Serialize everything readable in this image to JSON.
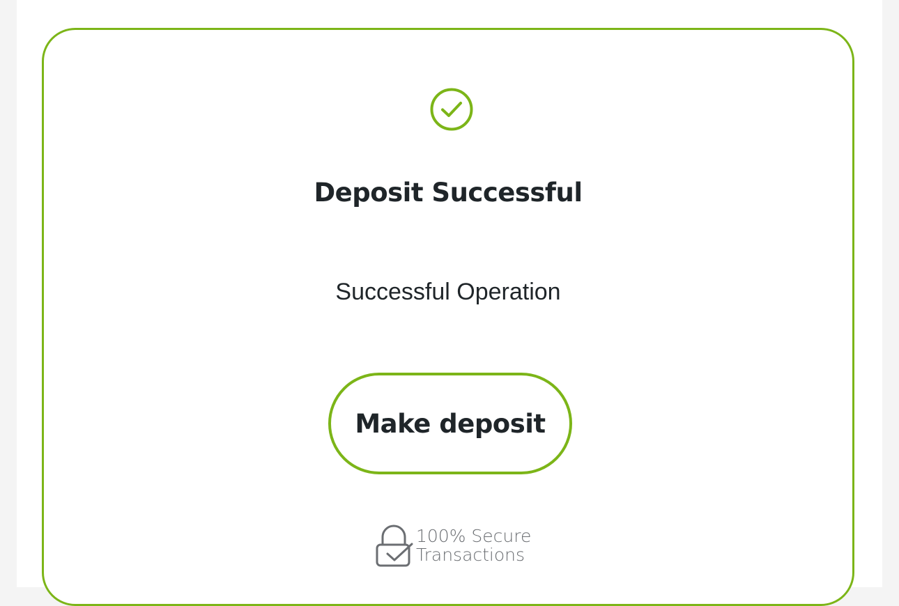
{
  "colors": {
    "accent": "#7cb518",
    "text_dark": "#1f2529",
    "text_muted": "#6b6e72",
    "background": "#f4f4f4",
    "card_background": "#ffffff"
  },
  "status": {
    "icon": "check-circle-icon",
    "title": "Deposit Successful",
    "message": "Successful Operation"
  },
  "actions": {
    "make_deposit_label": "Make deposit"
  },
  "security_badge": {
    "icon": "lock-check-icon",
    "line1": "100% Secure",
    "line2": "Transactions"
  }
}
